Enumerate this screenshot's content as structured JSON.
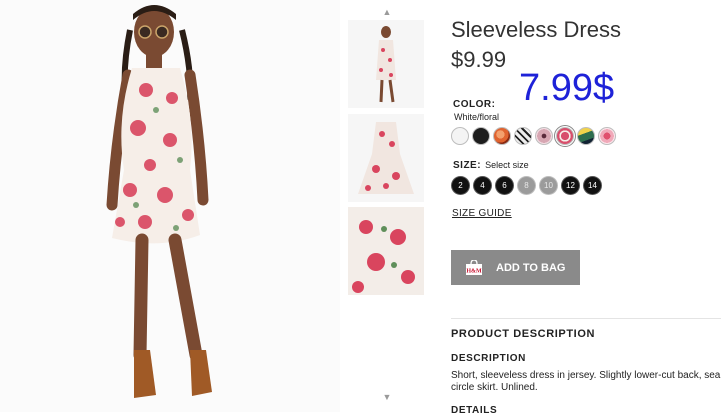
{
  "product": {
    "title": "Sleeveless Dress",
    "price": "$9.99",
    "sale_note": "7.99$"
  },
  "color": {
    "label": "COLOR:",
    "value": "White/floral",
    "swatches": [
      {
        "name": "white",
        "color": "#f4f4f4"
      },
      {
        "name": "black",
        "color": "#1d1d1d"
      },
      {
        "name": "orange-pattern",
        "color": "#e0632f"
      },
      {
        "name": "geometric-black-white",
        "color": "#e9e9e9"
      },
      {
        "name": "pink-pattern",
        "color": "#d7a6b2"
      },
      {
        "name": "white-floral",
        "color": "#d84f6c"
      },
      {
        "name": "green-chevron",
        "color": "#2e6e4e"
      },
      {
        "name": "pink-rose",
        "color": "#f0a9b9"
      }
    ]
  },
  "size": {
    "label": "SIZE:",
    "hint": "Select size",
    "options": [
      {
        "label": "2",
        "available": true
      },
      {
        "label": "4",
        "available": true
      },
      {
        "label": "6",
        "available": true
      },
      {
        "label": "8",
        "available": false
      },
      {
        "label": "10",
        "available": false
      },
      {
        "label": "12",
        "available": true
      },
      {
        "label": "14",
        "available": true
      }
    ],
    "guide_label": "SIZE GUIDE"
  },
  "actions": {
    "add_to_bag": "ADD TO BAG"
  },
  "description": {
    "section_title": "PRODUCT DESCRIPTION",
    "heading": "DESCRIPTION",
    "text": "Short, sleeveless dress in jersey. Slightly lower-cut back, sea circle skirt. Unlined.",
    "details_heading": "DETAILS"
  }
}
